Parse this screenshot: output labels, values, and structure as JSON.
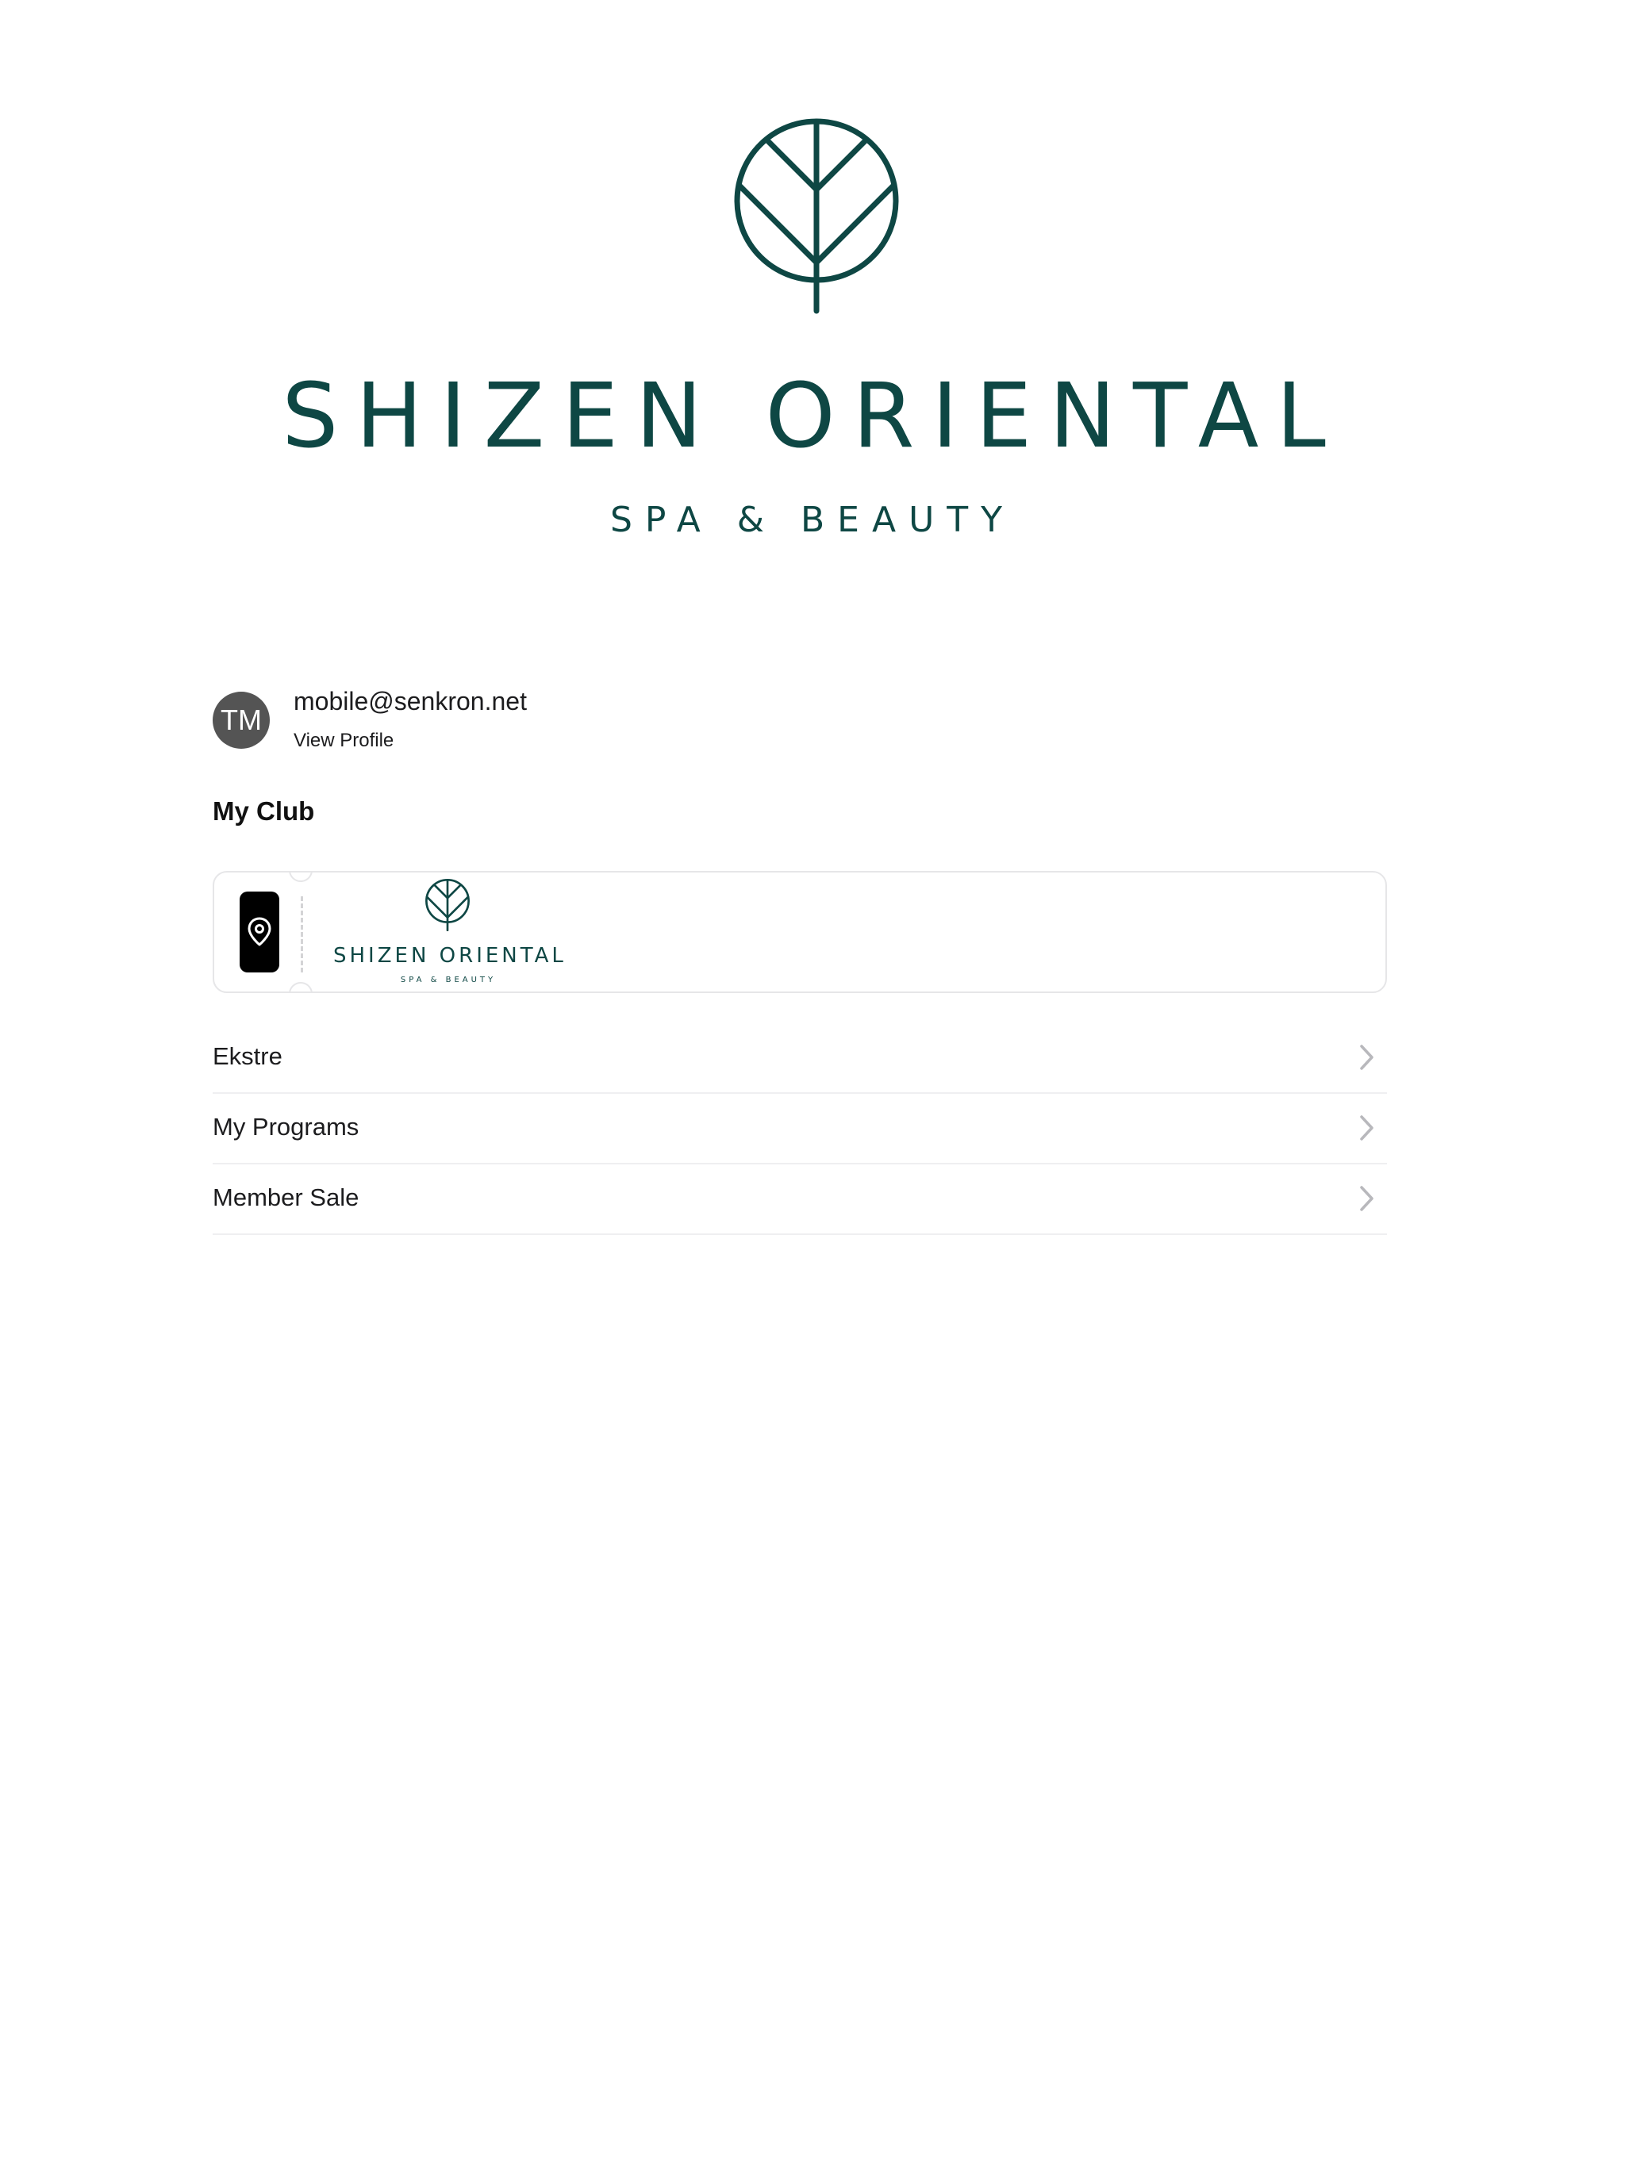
{
  "brand": {
    "name": "SHIZEN ORIENTAL",
    "tagline": "SPA & BEAUTY",
    "color": "#0e4744",
    "icon": "leaf-circle-logo-icon"
  },
  "profile": {
    "initials": "TM",
    "email": "mobile@senkron.net",
    "view_profile_label": "View Profile",
    "avatar_color": "#545454"
  },
  "club": {
    "section_title": "My Club",
    "card": {
      "action_icon": "location-pin-icon",
      "logo_name": "SHIZEN ORIENTAL",
      "logo_tagline": "SPA & BEAUTY"
    }
  },
  "menu": {
    "items": [
      {
        "label": "Ekstre",
        "icon": "chevron-right-icon"
      },
      {
        "label": "My Programs",
        "icon": "chevron-right-icon"
      },
      {
        "label": "Member Sale",
        "icon": "chevron-right-icon"
      }
    ]
  }
}
